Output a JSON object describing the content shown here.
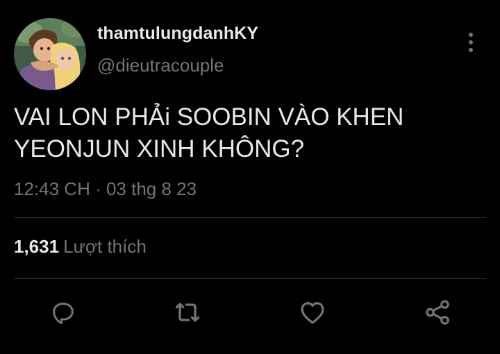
{
  "user": {
    "display_name": "thamtulungdanhKY",
    "handle": "@dieutracouple",
    "avatar_icon": "cartoon-couple-avatar"
  },
  "menu": {
    "icon": "more-vertical-icon"
  },
  "tweet": {
    "text_lines": [
      "VAI LON PHẢi SOOBIN VÀO KHEN",
      "YEONJUN XINH KHÔNG?"
    ],
    "timestamp": "12:43 CH · 03 thg 8 23"
  },
  "stats": {
    "likes_count": "1,631",
    "likes_label": "Lượt thích"
  },
  "actions": [
    {
      "name": "reply",
      "icon": "reply-icon"
    },
    {
      "name": "retweet",
      "icon": "retweet-icon"
    },
    {
      "name": "like",
      "icon": "heart-icon"
    },
    {
      "name": "share",
      "icon": "share-icon"
    }
  ],
  "colors": {
    "background": "#000000",
    "primary_text": "#e7e9ea",
    "secondary_text": "#71767b",
    "divider": "#2f3336"
  }
}
